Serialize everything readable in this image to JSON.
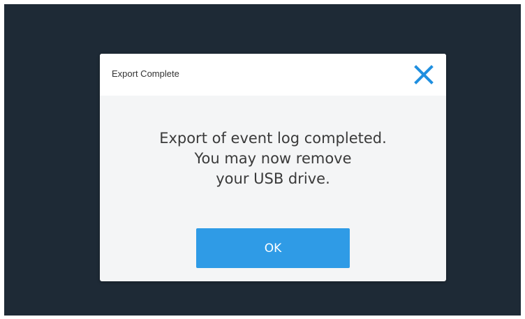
{
  "dialog": {
    "title": "Export Complete",
    "message_lines": [
      "Export of event log completed.",
      "You may now remove",
      "your USB drive."
    ],
    "ok_label": "OK",
    "close_icon": "close-icon"
  },
  "colors": {
    "background": "#1e2a36",
    "dialog_body": "#f4f5f6",
    "dialog_header": "#ffffff",
    "accent": "#2f9be6",
    "text": "#3a3a3a"
  }
}
